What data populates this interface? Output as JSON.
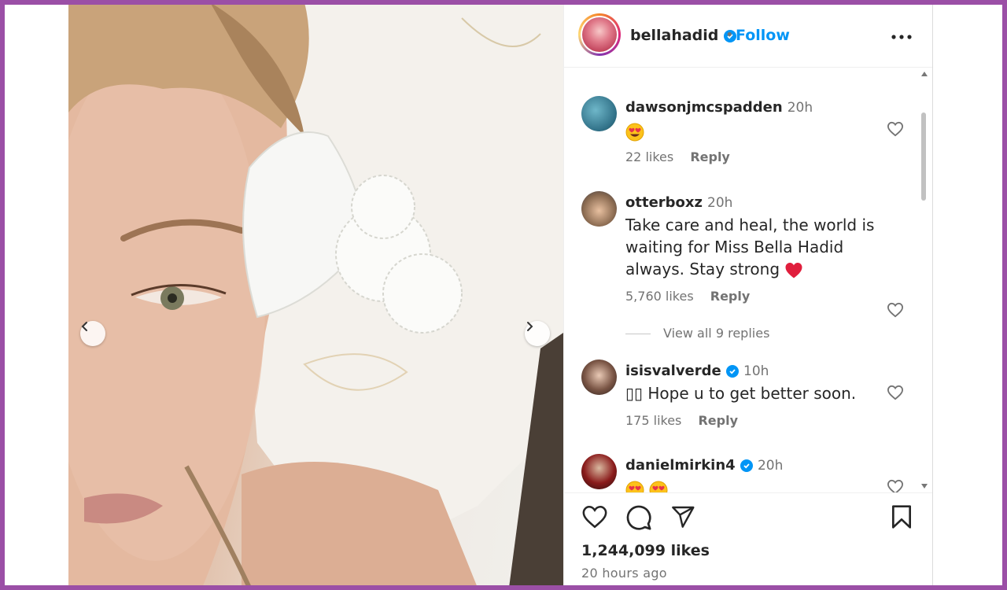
{
  "header": {
    "username": "bellahadid",
    "separator": "•",
    "follow_label": "Follow"
  },
  "comments": [
    {
      "username": "dawsonjmcspadden",
      "verified": false,
      "time": "20h",
      "text": "",
      "emojis": [
        "heart-eyes"
      ],
      "likes": "22 likes",
      "reply_label": "Reply"
    },
    {
      "username": "otterboxz",
      "verified": false,
      "time": "20h",
      "text": "Take care and heal, the world is waiting for Miss Bella Hadid always. Stay strong",
      "emojis": [
        "red-heart"
      ],
      "likes": "5,760 likes",
      "reply_label": "Reply",
      "view_replies": "View all 9 replies"
    },
    {
      "username": "isisvalverde",
      "verified": true,
      "time": "10h",
      "text": "▯▯ Hope u to get better soon.",
      "likes": "175 likes",
      "reply_label": "Reply"
    },
    {
      "username": "danielmirkin4",
      "verified": true,
      "time": "20h",
      "text": "",
      "emojis": [
        "heart-eyes",
        "heart-eyes"
      ]
    }
  ],
  "post": {
    "likes": "1,244,099 likes",
    "time_ago": "20 hours ago"
  },
  "colors": {
    "accent_blue": "#0095f6",
    "frame_purple": "#9b4fa6",
    "muted_text": "#737373"
  }
}
